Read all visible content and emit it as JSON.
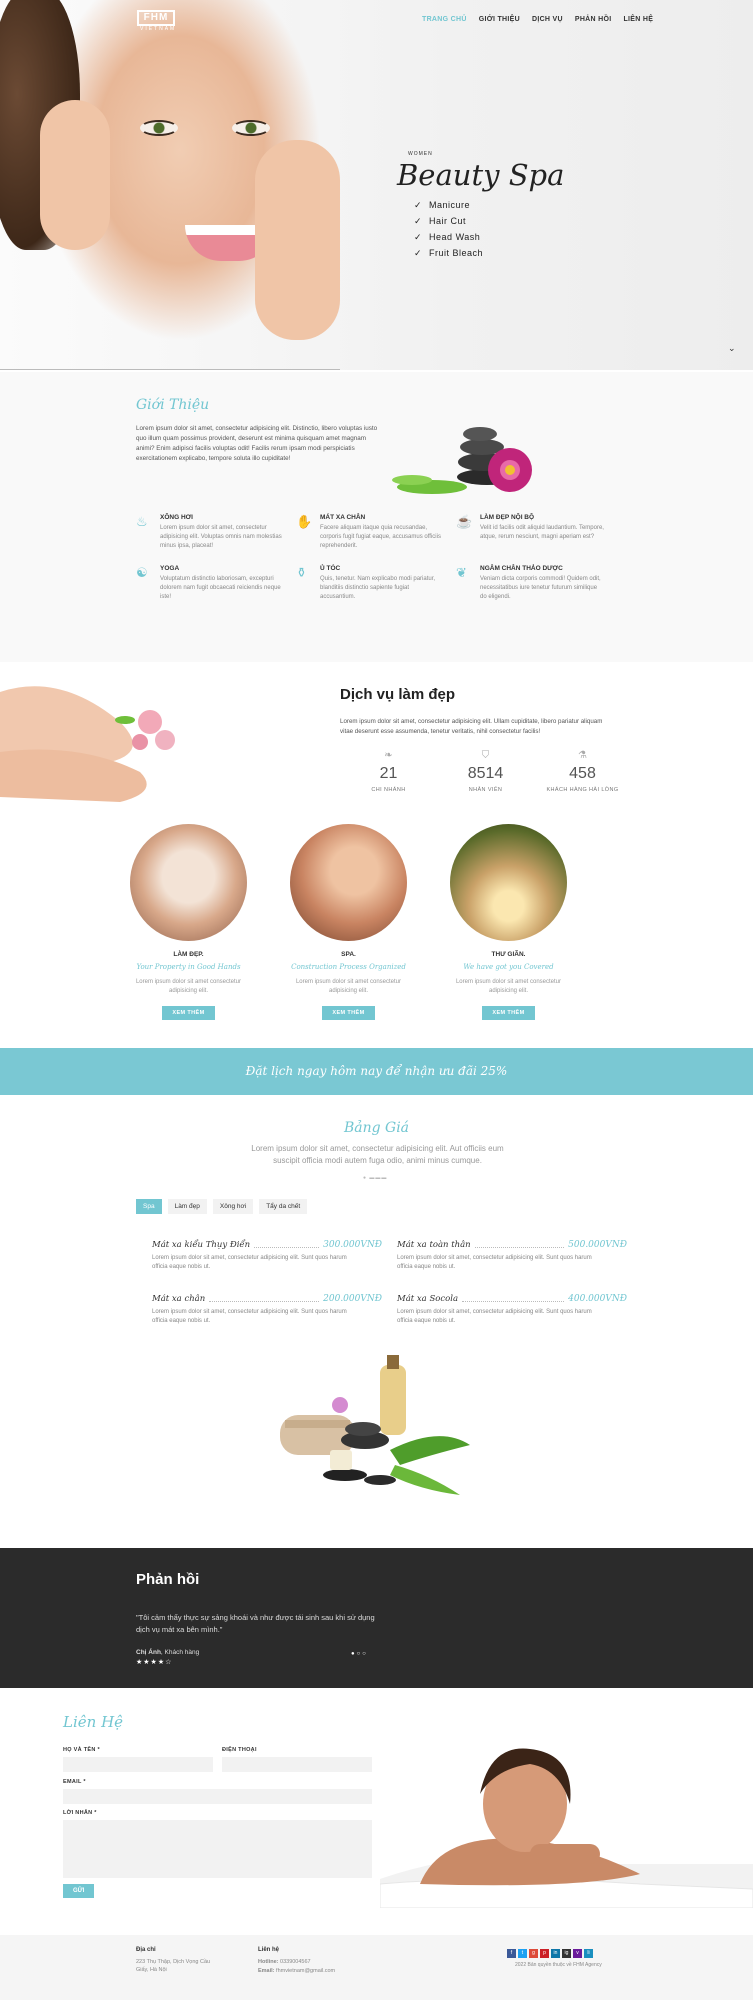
{
  "brand": {
    "logo": "FHM",
    "logo_sub": "VIETNAM"
  },
  "nav": {
    "items": [
      "TRANG CHỦ",
      "GIỚI THIỆU",
      "DỊCH VỤ",
      "PHẢN HỒI",
      "LIÊN HỆ"
    ]
  },
  "hero": {
    "kicker": "WOMEN",
    "title": "Beauty Spa",
    "list": [
      "Manicure",
      "Hair Cut",
      "Head Wash",
      "Fruit Bleach"
    ]
  },
  "about": {
    "title": "Giới Thiệu",
    "text": "Lorem ipsum dolor sit amet, consectetur adipisicing elit. Distinctio, libero voluptas iusto quo illum quam possimus provident, deserunt est minima quisquam amet magnam animi? Enim adipisci facilis voluptas odit! Facilis rerum ipsam modi perspiciatis exercitationem explicabo, tempore soluta illo cupiditate!",
    "features": [
      {
        "title": "XÔNG HƠI",
        "text": "Lorem ipsum dolor sit amet, consectetur adipisicing elit. Voluptas omnis nam molestias minus ipsa, placeat!"
      },
      {
        "title": "MÁT XA CHÂN",
        "text": "Facere aliquam itaque quia recusandae, corporis fugit fugiat eaque, accusamus officiis reprehenderit."
      },
      {
        "title": "LÀM ĐẸP NỘI BỘ",
        "text": "Velit id facilis odit aliquid laudantium. Tempore, atque, rerum nesciunt, magni aperiam est?"
      },
      {
        "title": "YOGA",
        "text": "Voluptatum distinctio laboriosam, excepturi dolorem nam fugit obcaecati reiciendis neque iste!"
      },
      {
        "title": "Ủ TÓC",
        "text": "Quis, tenetur. Nam explicabo modi pariatur, blanditiis distinctio sapiente fugiat accusantium."
      },
      {
        "title": "NGÂM CHÂN THẢO DƯỢC",
        "text": "Veniam dicta corporis commodi! Quidem odit, necessitatibus iure tenetur futurum similique do eligendi."
      }
    ]
  },
  "services": {
    "title": "Dịch vụ làm đẹp",
    "text": "Lorem ipsum dolor sit amet, consectetur adipisicing elit. Ullam cupiditate, libero pariatur aliquam vitae deserunt esse assumenda, tenetur veritatis, nihil consectetur facilis!",
    "stats": [
      {
        "num": "21",
        "label": "CHI NHÁNH"
      },
      {
        "num": "8514",
        "label": "NHÂN VIÊN"
      },
      {
        "num": "458",
        "label": "KHÁCH HÀNG HÀI LÒNG"
      }
    ],
    "cards": [
      {
        "title": "LÀM ĐẸP.",
        "sub": "Your Property in Good Hands",
        "text": "Lorem ipsum dolor sit amet consectetur adipisicing elit.",
        "btn": "XEM THÊM"
      },
      {
        "title": "SPA.",
        "sub": "Construction Process Organized",
        "text": "Lorem ipsum dolor sit amet consectetur adipisicing elit.",
        "btn": "XEM THÊM"
      },
      {
        "title": "THƯ GIÃN.",
        "sub": "We have got you Covered",
        "text": "Lorem ipsum dolor sit amet consectetur adipisicing elit.",
        "btn": "XEM THÊM"
      }
    ]
  },
  "banner": {
    "text": "Đặt lịch ngay hôm nay để nhận ưu đãi 25%"
  },
  "price": {
    "title": "Bảng Giá",
    "sub": "Lorem ipsum dolor sit amet, consectetur adipisicing elit. Aut officiis eum suscipit officia modi autem fuga odio, animi minus cumque.",
    "tabs": [
      "Spa",
      "Làm đẹp",
      "Xông hơi",
      "Tẩy da chết"
    ],
    "items": [
      {
        "name": "Mát xa kiểu Thụy Điển",
        "price": "300.000VNĐ",
        "text": "Lorem ipsum dolor sit amet, consectetur adipisicing elit. Sunt quos harum officia eaque nobis ut."
      },
      {
        "name": "Mát xa toàn thân",
        "price": "500.000VNĐ",
        "text": "Lorem ipsum dolor sit amet, consectetur adipisicing elit. Sunt quos harum officia eaque nobis ut."
      },
      {
        "name": "Mát xa chân",
        "price": "200.000VNĐ",
        "text": "Lorem ipsum dolor sit amet, consectetur adipisicing elit. Sunt quos harum officia eaque nobis ut."
      },
      {
        "name": "Mát xa Socola",
        "price": "400.000VNĐ",
        "text": "Lorem ipsum dolor sit amet, consectetur adipisicing elit. Sunt quos harum officia eaque nobis ut."
      }
    ]
  },
  "testimonial": {
    "title": "Phản hồi",
    "quote": "\"Tôi cảm thấy thực sự sảng khoái và như được tái sinh sau khi sử dụng dịch vụ mát xa bên mình.\"",
    "author": "Chị Ánh",
    "role": ", Khách hàng",
    "stars": "★★★★☆",
    "pager": "●○○"
  },
  "contact": {
    "title": "Liên Hệ",
    "name_label": "HỌ VÀ TÊN *",
    "phone_label": "ĐIỆN THOẠI",
    "email_label": "EMAIL *",
    "msg_label": "LỜI NHẮN *",
    "send": "GỬI"
  },
  "footer": {
    "addr_title": "Địa chỉ",
    "addr": "223 Thụ Thập, Dịch Vọng Cầu Giấy, Hà Nội",
    "contact_title": "Liên hệ",
    "hotline_label": "Hotline:",
    "hotline": "0339004567",
    "email_label": "Email:",
    "email": "fhmvietnam@gmail.com",
    "copyright": "2022 Bản quyền thuộc về FHM Agency",
    "social": [
      "f",
      "t",
      "g",
      "p",
      "in",
      "ig",
      "v",
      "li"
    ]
  }
}
